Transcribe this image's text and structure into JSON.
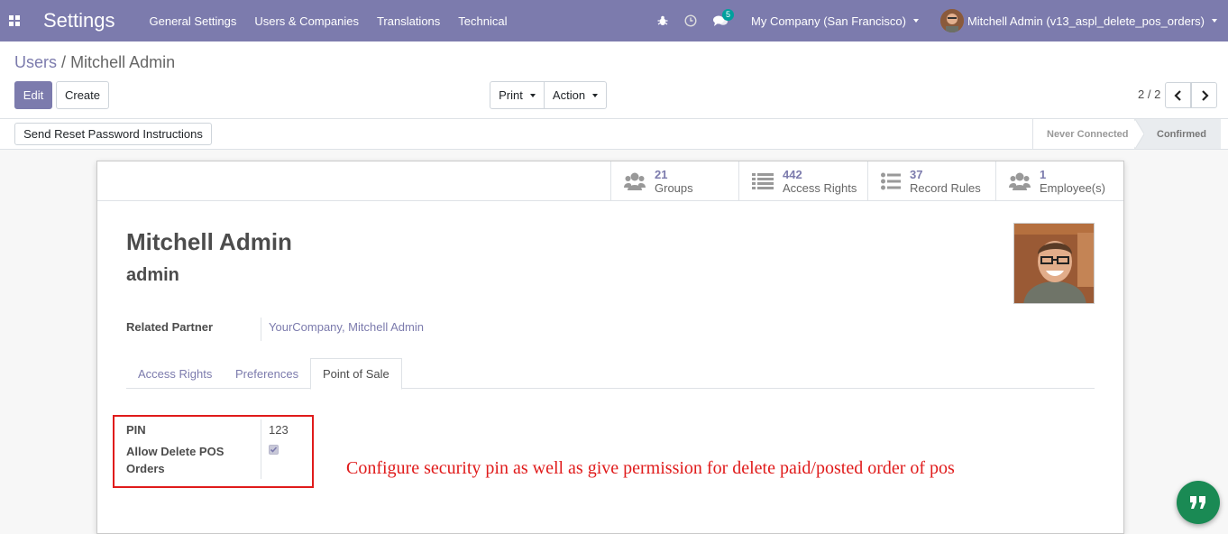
{
  "navbar": {
    "app_name": "Settings",
    "menu": [
      "General Settings",
      "Users & Companies",
      "Translations",
      "Technical"
    ],
    "messages_badge": "5",
    "company": "My Company (San Francisco)",
    "user": "Mitchell Admin (v13_aspl_delete_pos_orders)",
    "accent_color": "#7c7bad"
  },
  "breadcrumb": {
    "parent": "Users",
    "separator": "/",
    "current": "Mitchell Admin"
  },
  "toolbar": {
    "edit": "Edit",
    "create": "Create",
    "print": "Print",
    "action": "Action",
    "pager": "2 / 2"
  },
  "statusbar": {
    "reset_button": "Send Reset Password Instructions",
    "stages": [
      "Never Connected",
      "Confirmed"
    ],
    "active_stage": "Confirmed"
  },
  "smart_buttons": [
    {
      "count": "21",
      "label": "Groups",
      "icon": "users-icon"
    },
    {
      "count": "442",
      "label": "Access Rights",
      "icon": "list-icon"
    },
    {
      "count": "37",
      "label": "Record Rules",
      "icon": "list-ul-icon"
    },
    {
      "count": "1",
      "label": "Employee(s)",
      "icon": "users-icon"
    }
  ],
  "user": {
    "name": "Mitchell Admin",
    "login": "admin",
    "related_partner_label": "Related Partner",
    "related_partner": "YourCompany, Mitchell Admin"
  },
  "tabs": [
    "Access Rights",
    "Preferences",
    "Point of Sale"
  ],
  "active_tab": "Point of Sale",
  "pos": {
    "pin_label": "PIN",
    "pin": "123",
    "allow_delete_label_1": "Allow Delete POS",
    "allow_delete_label_2": "Orders",
    "allow_delete_checked": true
  },
  "annotation": "Configure security pin as well as give permission for delete paid/posted order of pos"
}
